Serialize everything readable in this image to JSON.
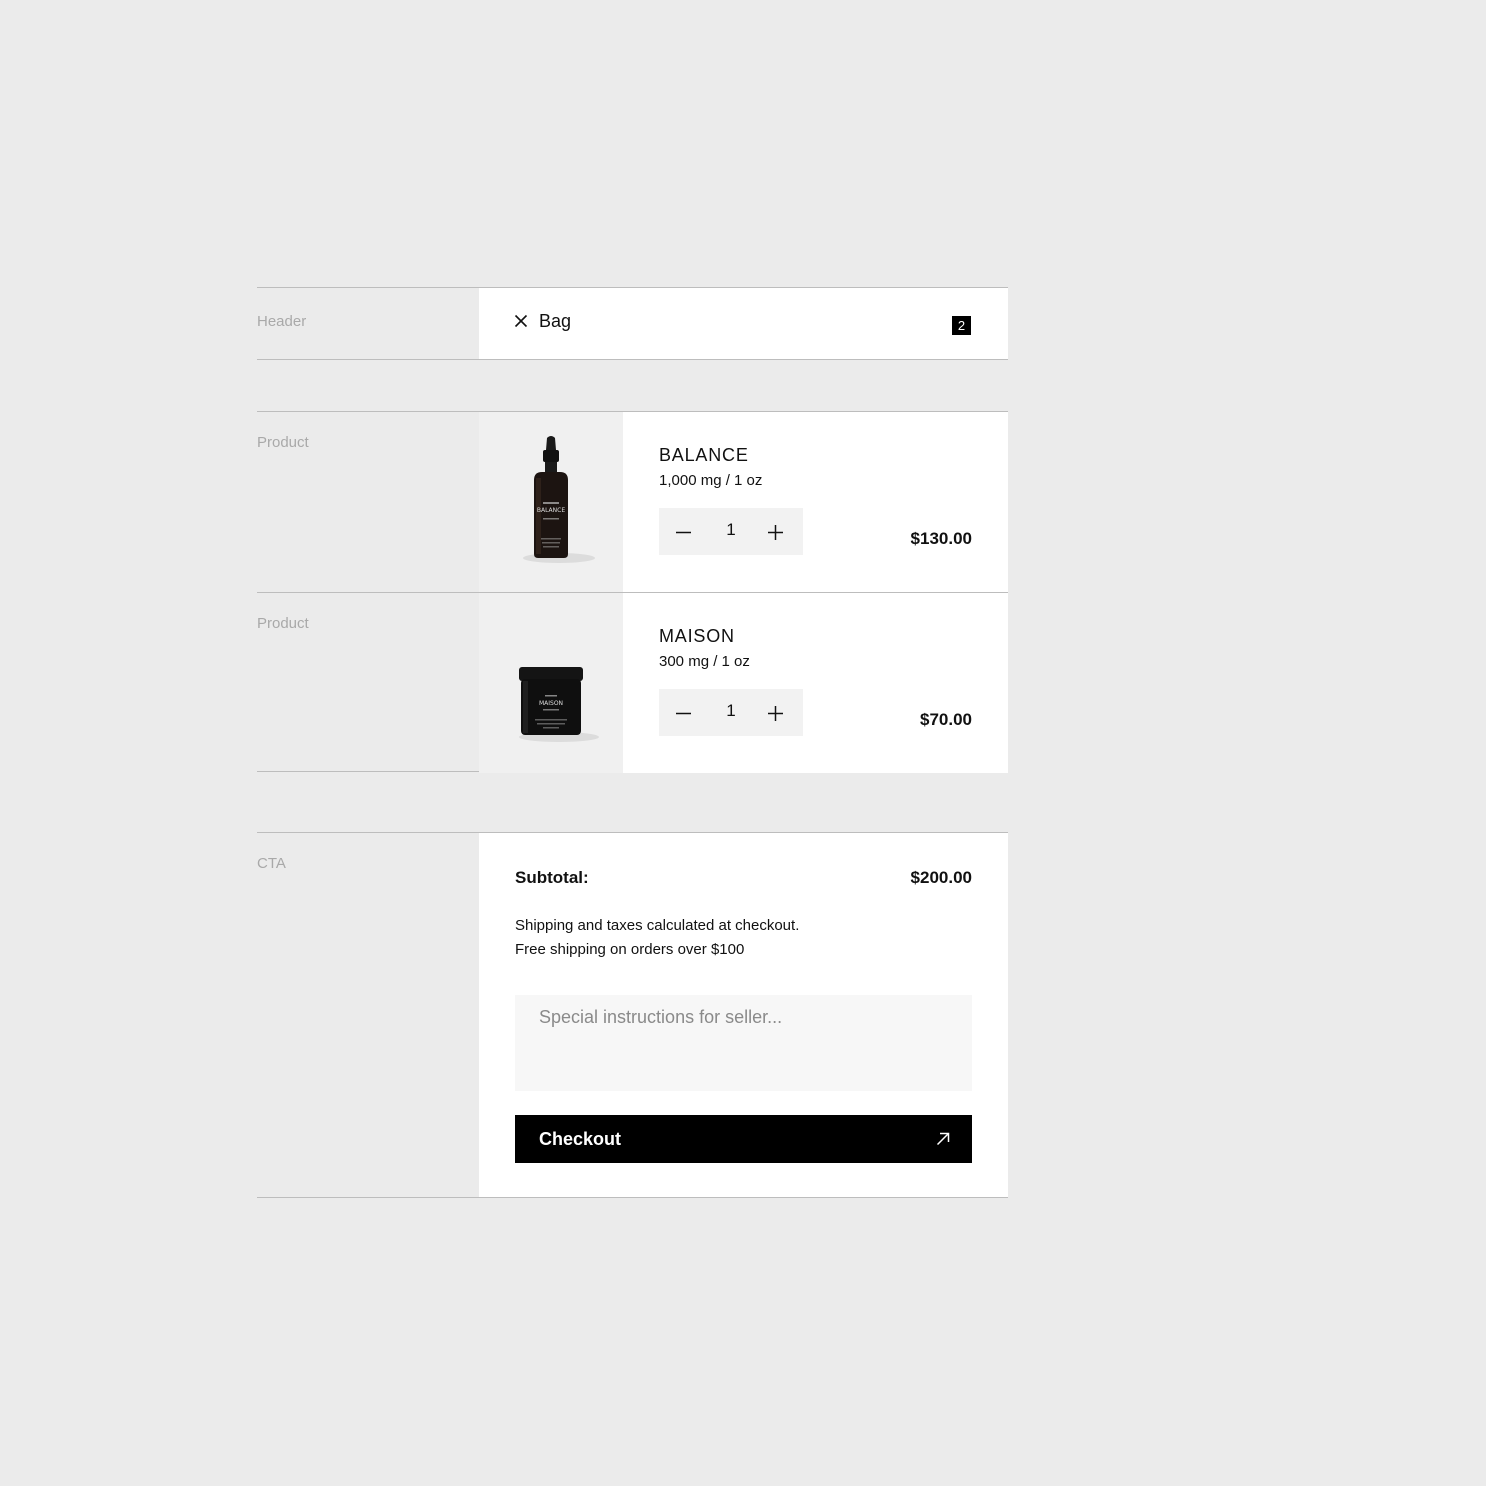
{
  "sections": {
    "header": "Header",
    "product": "Product",
    "cta": "CTA"
  },
  "header": {
    "title": "Bag",
    "count": "2",
    "close_icon": "close-icon"
  },
  "products": [
    {
      "name": "BALANCE",
      "variant": "1,000 mg / 1 oz",
      "quantity": "1",
      "price": "$130.00",
      "image": "dropper-bottle",
      "image_label": "BALANCE"
    },
    {
      "name": "MAISON",
      "variant": "300 mg / 1 oz",
      "quantity": "1",
      "price": "$70.00",
      "image": "jar",
      "image_label": "MAISON"
    }
  ],
  "cta": {
    "subtotal_label": "Subtotal:",
    "subtotal_value": "$200.00",
    "note_line1": "Shipping and taxes calculated at checkout.",
    "note_line2": "Free shipping on orders over $100",
    "instructions_placeholder": "Special instructions for seller...",
    "checkout_label": "Checkout",
    "checkout_icon": "arrow-up-right-icon"
  },
  "colors": {
    "background": "#ebebeb",
    "panel": "#ffffff",
    "accent": "#000000",
    "muted_label": "#a9a9a9"
  }
}
